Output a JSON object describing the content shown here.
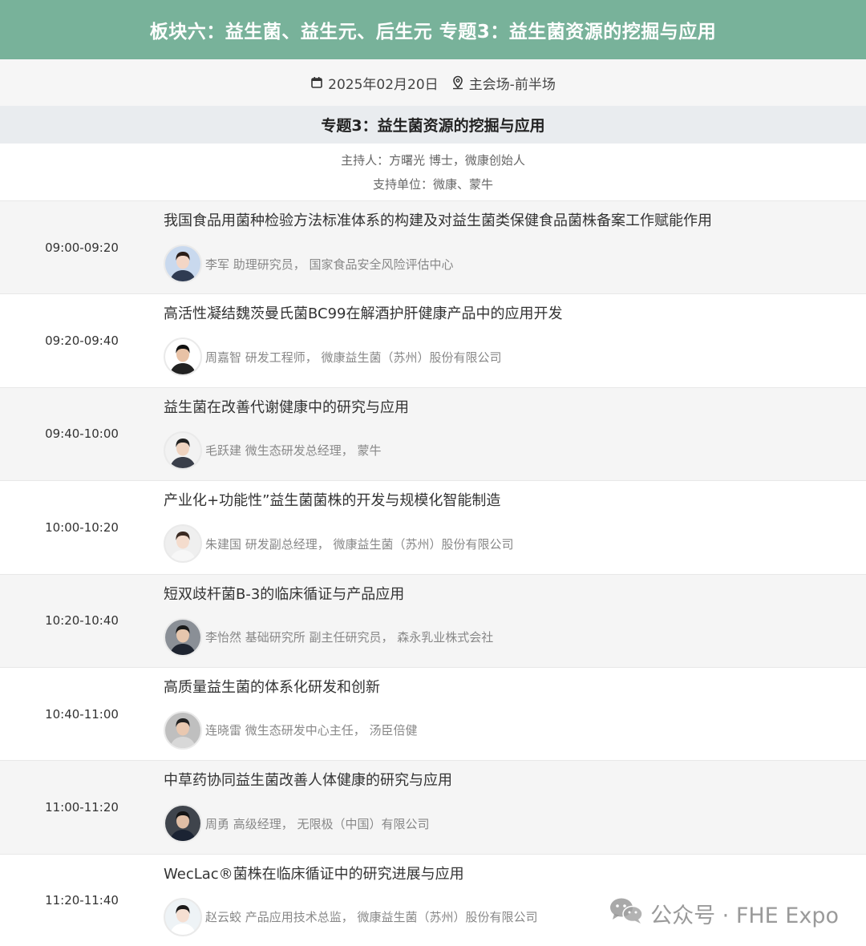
{
  "header": {
    "title": "板块六：益生菌、益生元、后生元 专题3：益生菌资源的挖掘与应用"
  },
  "meta": {
    "date": "2025年02月20日",
    "venue": "主会场-前半场",
    "date_icon": "calendar-icon",
    "venue_icon": "location-pin-icon"
  },
  "topic": {
    "title": "专题3：益生菌资源的挖掘与应用",
    "host": "主持人：方曙光 博士，微康创始人",
    "support": "支持单位：微康、蒙牛"
  },
  "sessions": [
    {
      "time": "09:00-09:20",
      "title": "我国食品用菌种检验方法标准体系的构建及对益生菌类保健食品菌株备案工作赋能作用",
      "speaker": "李军 助理研究员， 国家食品安全风险评估中心"
    },
    {
      "time": "09:20-09:40",
      "title": "高活性凝结魏茨曼氏菌BC99在解酒护肝健康产品中的应用开发",
      "speaker": "周嘉智 研发工程师， 微康益生菌（苏州）股份有限公司"
    },
    {
      "time": "09:40-10:00",
      "title": "益生菌在改善代谢健康中的研究与应用",
      "speaker": "毛跃建 微生态研发总经理， 蒙牛"
    },
    {
      "time": "10:00-10:20",
      "title": "产业化+功能性”益生菌菌株的开发与规模化智能制造",
      "speaker": "朱建国 研发副总经理， 微康益生菌（苏州）股份有限公司"
    },
    {
      "time": "10:20-10:40",
      "title": "短双歧杆菌B-3的临床循证与产品应用",
      "speaker": "李怡然 基础研究所 副主任研究员， 森永乳业株式会社"
    },
    {
      "time": "10:40-11:00",
      "title": "高质量益生菌的体系化研发和创新",
      "speaker": "连晓雷 微生态研发中心主任， 汤臣倍健"
    },
    {
      "time": "11:00-11:20",
      "title": "中草药协同益生菌改善人体健康的研究与应用",
      "speaker": "周勇 高级经理， 无限极（中国）有限公司"
    },
    {
      "time": "11:20-11:40",
      "title": "WecLac®菌株在临床循证中的研究进展与应用",
      "speaker": "赵云蛟 产品应用技术总监， 微康益生菌（苏州）股份有限公司"
    }
  ],
  "watermark": {
    "text": "公众号 · FHE Expo",
    "icon": "wechat-icon"
  }
}
